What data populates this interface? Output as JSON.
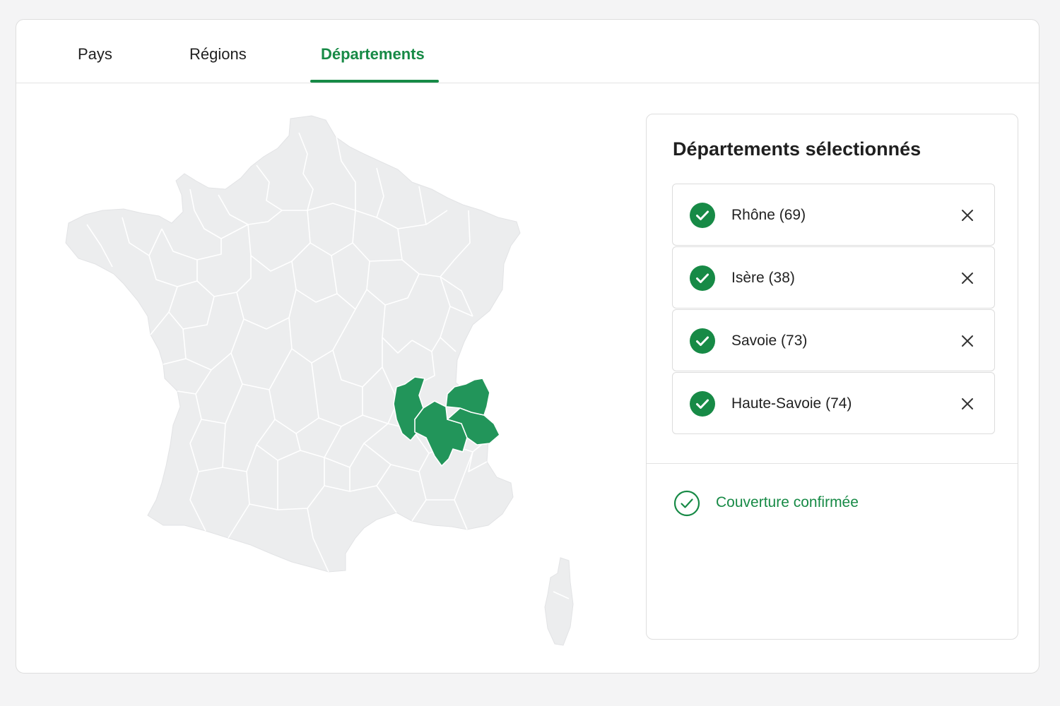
{
  "tabs": [
    {
      "label": "Pays",
      "active": false
    },
    {
      "label": "Régions",
      "active": false
    },
    {
      "label": "Départements",
      "active": true
    }
  ],
  "map": {
    "selected_departments": [
      "Rhône",
      "Isère",
      "Savoie",
      "Haute-Savoie"
    ],
    "base_color": "#ecedee",
    "border_color": "#ffffff",
    "selected_color": "#22955a"
  },
  "panel": {
    "title": "Départements sélectionnés",
    "items": [
      {
        "label": "Rhône (69)",
        "check_icon": "check-circle-icon",
        "remove_icon": "close-icon"
      },
      {
        "label": "Isère (38)",
        "check_icon": "check-circle-icon",
        "remove_icon": "close-icon"
      },
      {
        "label": "Savoie (73)",
        "check_icon": "check-circle-icon",
        "remove_icon": "close-icon"
      },
      {
        "label": "Haute-Savoie (74)",
        "check_icon": "check-circle-icon",
        "remove_icon": "close-icon"
      }
    ],
    "status": {
      "text": "Couverture confirmée",
      "icon": "check-circle-outline-icon"
    }
  },
  "colors": {
    "accent": "#178a46",
    "border": "#dedede"
  }
}
